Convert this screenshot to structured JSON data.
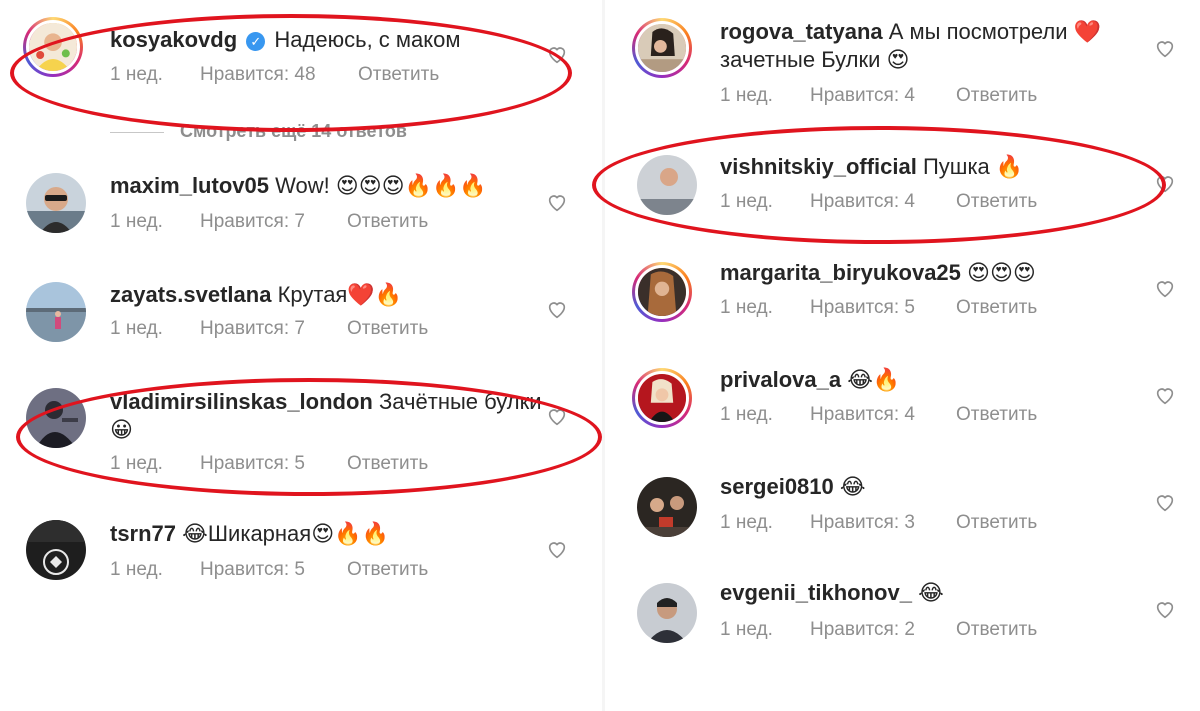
{
  "left_comments": [
    {
      "username": "kosyakovdg",
      "verified": true,
      "message": "Надеюсь, с маком",
      "time": "1 нед.",
      "likes": "Нравится: 48",
      "reply": "Ответить"
    },
    {
      "username": "maxim_lutov05",
      "message": "Wow! 😍😍😍🔥🔥🔥",
      "time": "1 нед.",
      "likes": "Нравится: 7",
      "reply": "Ответить"
    },
    {
      "username": "zayats.svetlana",
      "message": "Крутая❤️🔥",
      "time": "1 нед.",
      "likes": "Нравится: 7",
      "reply": "Ответить"
    },
    {
      "username": "vladimirsilinskas_london",
      "message": "Зачётные булки 😀",
      "time": "1 нед.",
      "likes": "Нравится: 5",
      "reply": "Ответить"
    },
    {
      "username": "tsrn77",
      "message": "😂Шикарная😍🔥🔥",
      "time": "1 нед.",
      "likes": "Нравится: 5",
      "reply": "Ответить"
    }
  ],
  "view_more": "Смотреть ещё 14 ответов",
  "right_comments": [
    {
      "username": "rogova_tatyana",
      "message": "А мы посмотрели ❤️ зачетные Булки 😍",
      "time": "1 нед.",
      "likes": "Нравится: 4",
      "reply": "Ответить"
    },
    {
      "username": "vishnitskiy_official",
      "message": "Пушка 🔥",
      "time": "1 нед.",
      "likes": "Нравится: 4",
      "reply": "Ответить"
    },
    {
      "username": "margarita_biryukova25",
      "message": "😍😍😍",
      "time": "1 нед.",
      "likes": "Нравится: 5",
      "reply": "Ответить"
    },
    {
      "username": "privalova_a",
      "message": "😂🔥",
      "time": "1 нед.",
      "likes": "Нравится: 4",
      "reply": "Ответить"
    },
    {
      "username": "sergei0810",
      "message": "😂",
      "time": "1 нед.",
      "likes": "Нравится: 3",
      "reply": "Ответить"
    },
    {
      "username": "evgenii_tikhonov_",
      "message": "😂",
      "time": "1 нед.",
      "likes": "Нравится: 2",
      "reply": "Ответить"
    }
  ],
  "icons": {
    "like": "heart-outline-icon",
    "verified": "verified-badge-icon"
  },
  "colors": {
    "highlight_oval": "#e0141e",
    "meta_text": "#8e8e8e",
    "verified": "#3897f0"
  }
}
